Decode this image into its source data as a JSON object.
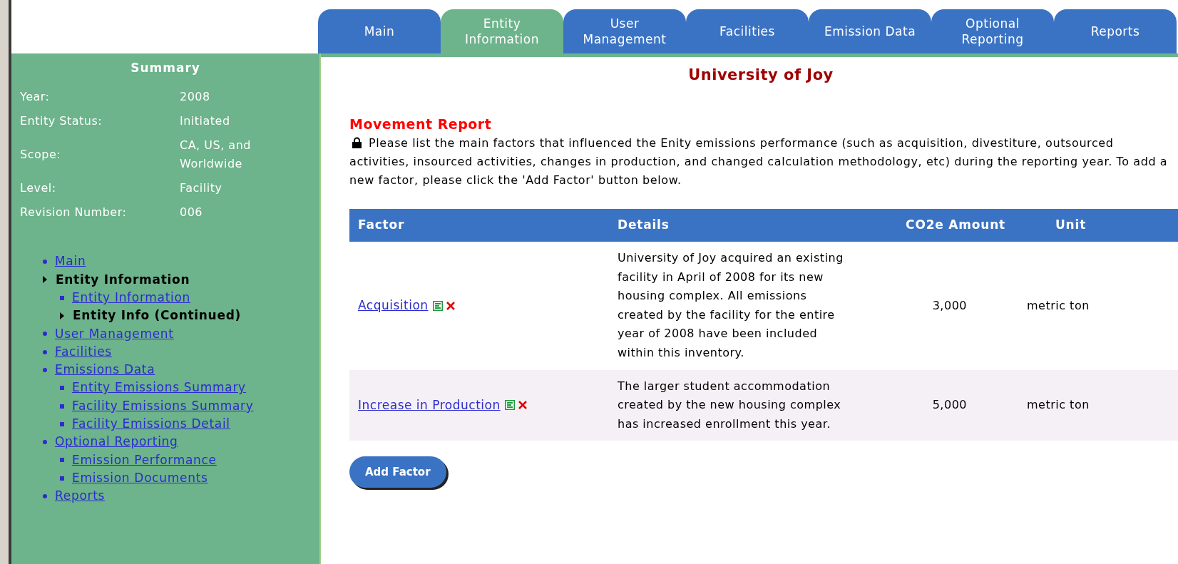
{
  "tabs": [
    {
      "label": "Main",
      "selected": false
    },
    {
      "label": "Entity Information",
      "selected": true
    },
    {
      "label": "User Management",
      "selected": false
    },
    {
      "label": "Facilities",
      "selected": false
    },
    {
      "label": "Emission Data",
      "selected": false
    },
    {
      "label": "Optional Reporting",
      "selected": false
    },
    {
      "label": "Reports",
      "selected": false
    }
  ],
  "summary": {
    "title": "Summary",
    "rows": [
      {
        "label": "Year:",
        "value": "2008"
      },
      {
        "label": "Entity Status:",
        "value": "Initiated"
      },
      {
        "label": "Scope:",
        "value": "CA, US, and Worldwide"
      },
      {
        "label": "Level:",
        "value": "Facility"
      },
      {
        "label": "Revision Number:",
        "value": "006"
      }
    ]
  },
  "sidebar": {
    "items": [
      {
        "label": "Main",
        "current": false
      },
      {
        "label": "Entity Information",
        "current": true,
        "children": [
          {
            "label": "Entity Information",
            "current": false
          },
          {
            "label": "Entity Info (Continued)",
            "current": true
          }
        ]
      },
      {
        "label": "User Management",
        "current": false
      },
      {
        "label": "Facilities",
        "current": false
      },
      {
        "label": "Emissions Data",
        "current": false,
        "children": [
          {
            "label": "Entity Emissions Summary",
            "current": false
          },
          {
            "label": "Facility Emissions Summary",
            "current": false
          },
          {
            "label": "Facility Emissions Detail",
            "current": false
          }
        ]
      },
      {
        "label": "Optional Reporting",
        "current": false,
        "children": [
          {
            "label": "Emission Performance",
            "current": false
          },
          {
            "label": "Emission Documents",
            "current": false
          }
        ]
      },
      {
        "label": "Reports",
        "current": false
      }
    ]
  },
  "page_title": "University of Joy",
  "section_title": "Movement Report",
  "instructions": "Please list the main factors that influenced the Enity emissions performance (such as acquisition, divestiture, outsourced activities, insourced activities, changes in production, and changed calculation methodology, etc) during the reporting year. To add a new factor, please click the 'Add Factor' button below.",
  "table": {
    "columns": [
      "Factor",
      "Details",
      "CO2e Amount",
      "Unit"
    ],
    "rows": [
      {
        "factor": "Acquisition",
        "details": "University of Joy acquired an existing facility in April of 2008 for its new housing complex. All emissions created by the facility for the entire year of 2008 have been included within this inventory.",
        "amount": "3,000",
        "unit": "metric ton"
      },
      {
        "factor": "Increase in Production",
        "details": "The larger student accommodation created by the new housing complex has increased enrollment this year.",
        "amount": "5,000",
        "unit": "metric ton"
      }
    ]
  },
  "add_button": "Add Factor"
}
